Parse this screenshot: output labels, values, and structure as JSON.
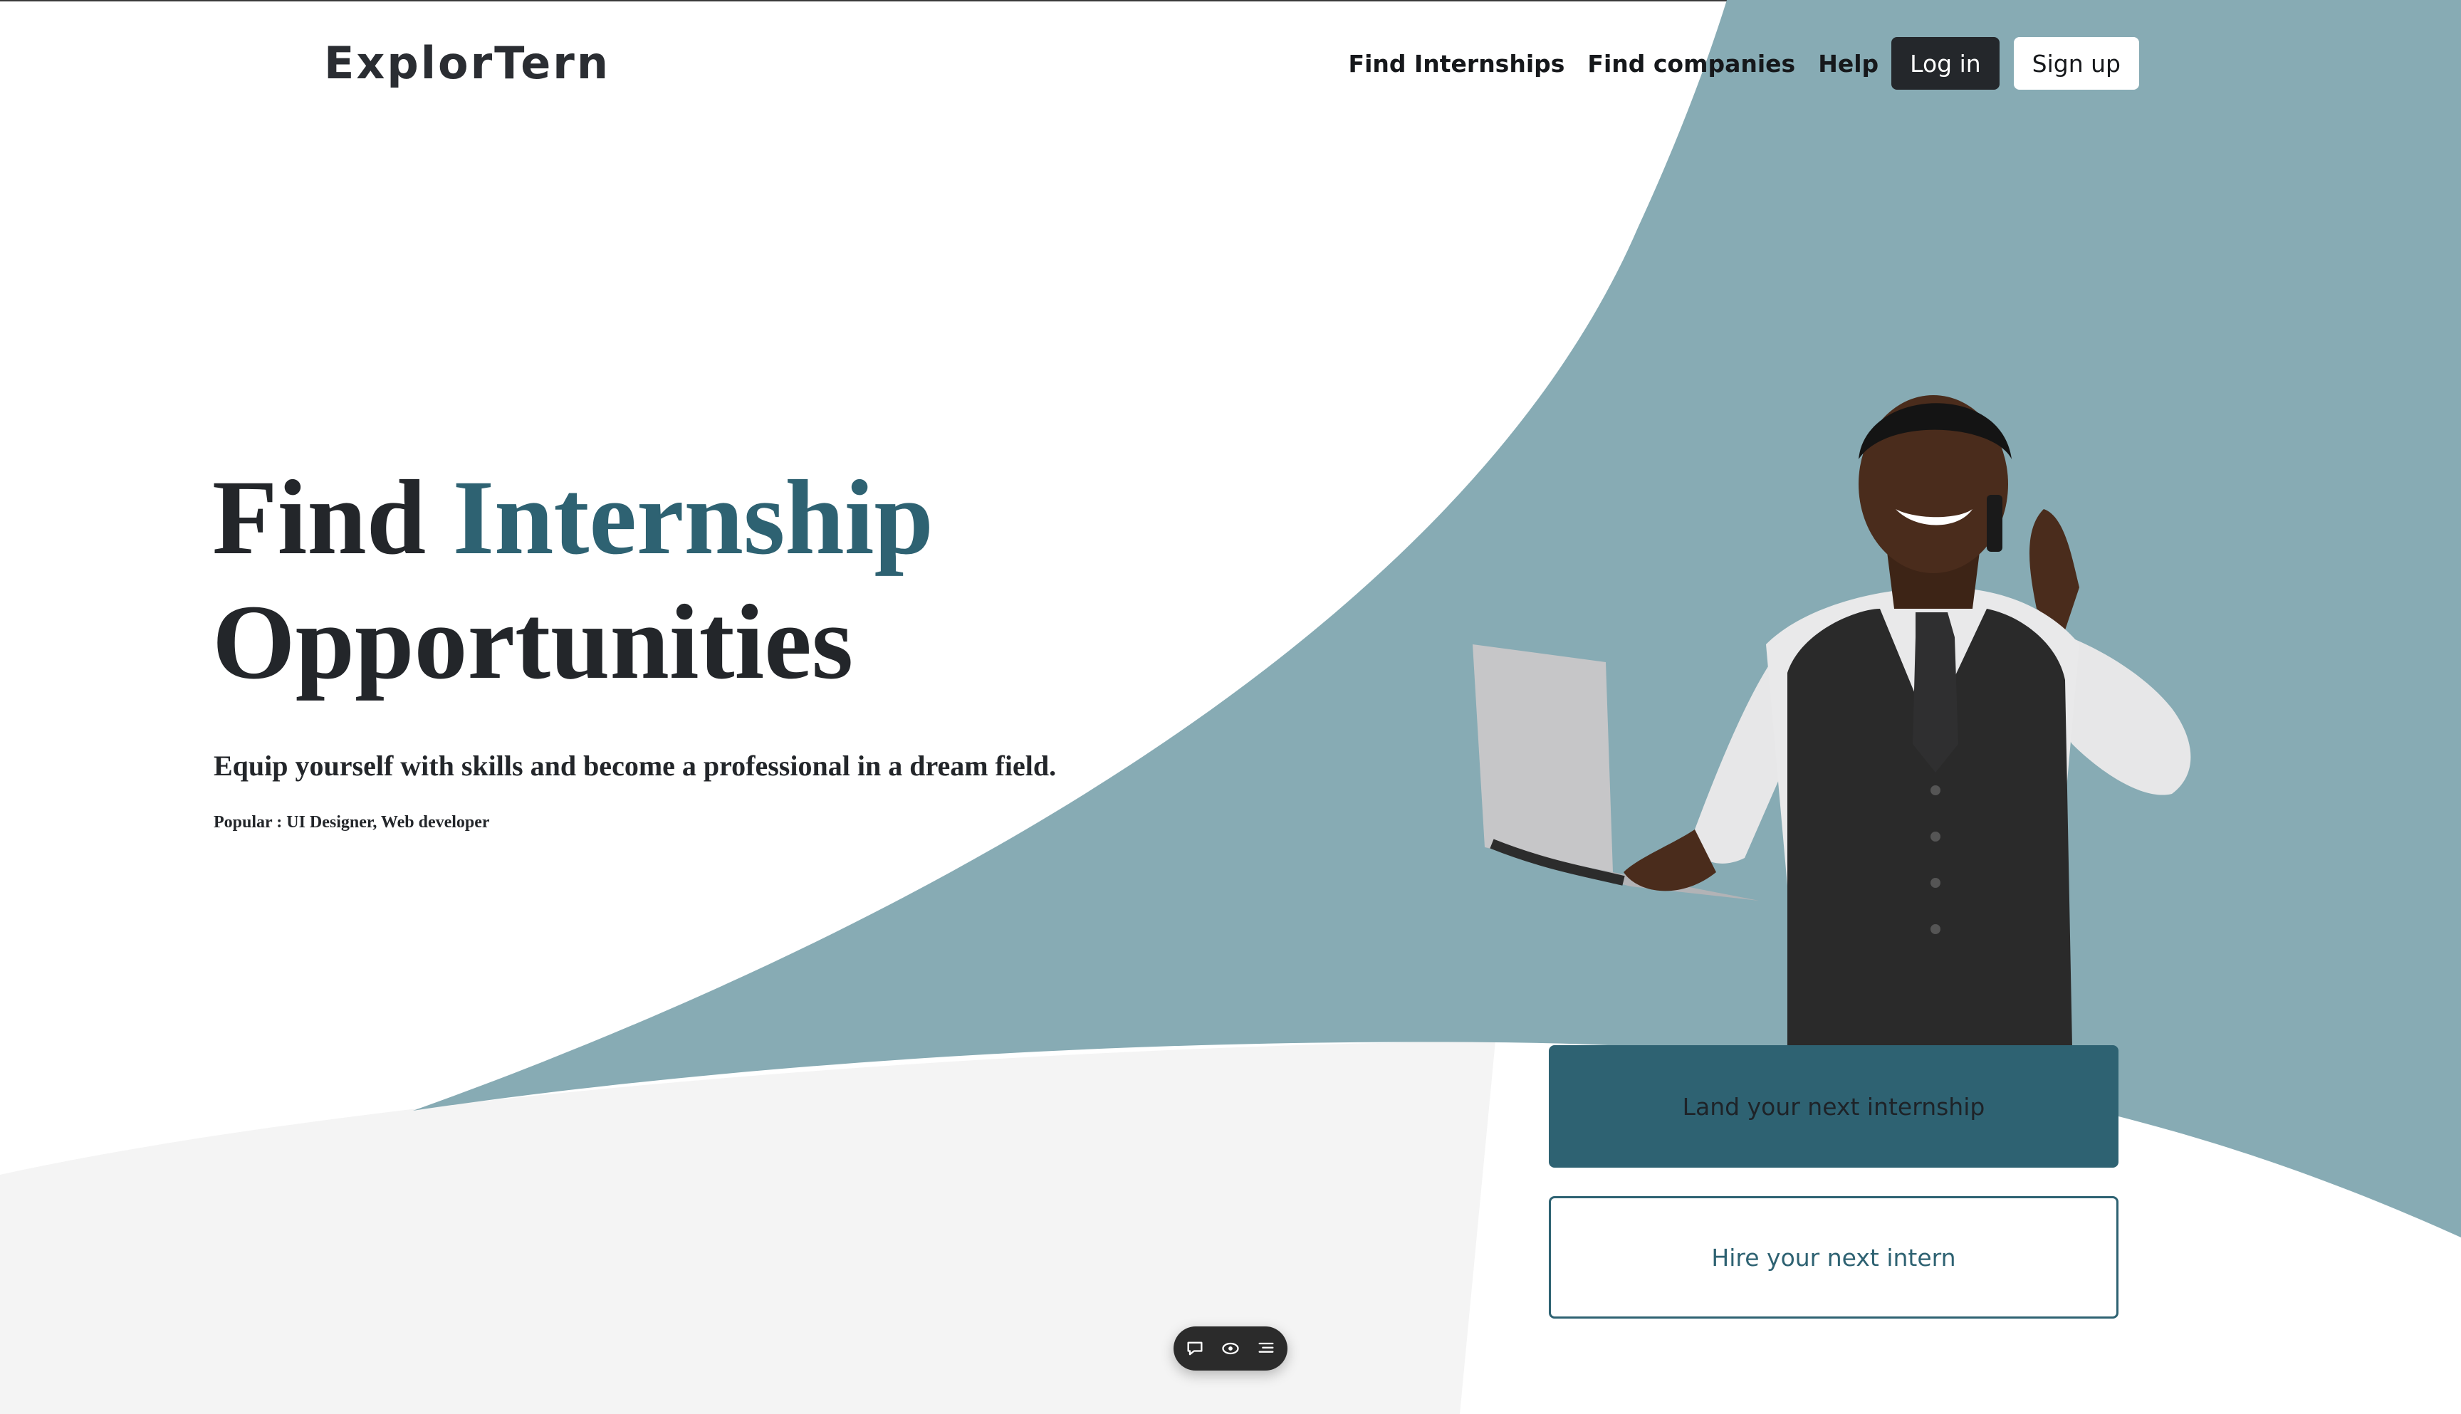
{
  "brand": {
    "logo_text": "ExplorTern"
  },
  "nav": {
    "links": [
      "Find Internships",
      "Find companies",
      "Help"
    ],
    "login_label": "Log in",
    "signup_label": "Sign up"
  },
  "hero": {
    "title_part1": "Find",
    "title_accent": "Internship",
    "title_line2": "Opportunities",
    "subtitle": "Equip yourself with skills and become a professional in a dream field.",
    "popular": "Popular : UI Designer, Web developer"
  },
  "cta": {
    "primary_label": "Land your next internship",
    "secondary_label": "Hire your next intern"
  },
  "toolbar": {
    "icons": [
      "comment-icon",
      "eye-icon",
      "list-icon"
    ]
  },
  "colors": {
    "accent": "#2e6272",
    "teal_background": "#87abb4",
    "dark": "#24272b"
  }
}
